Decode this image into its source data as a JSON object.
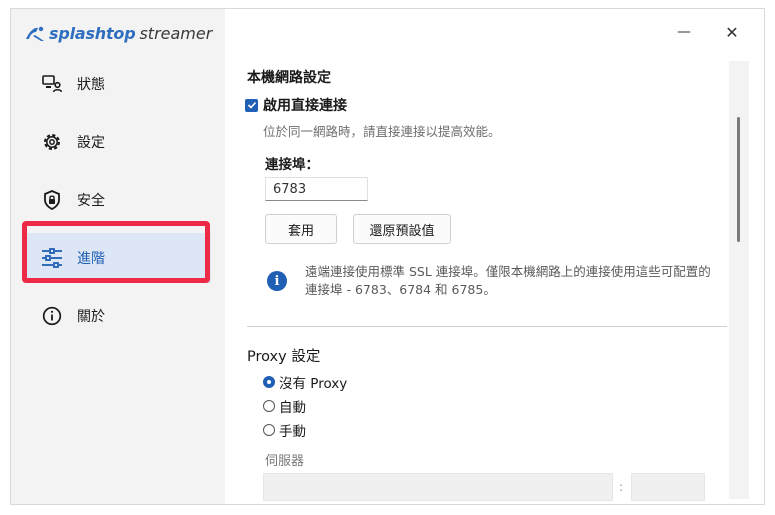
{
  "app": {
    "brand": "splashtop",
    "product": "streamer",
    "minimize_glyph": "—",
    "close_glyph": "✕"
  },
  "sidebar": {
    "items": [
      {
        "label": "狀態",
        "icon": "status-icon"
      },
      {
        "label": "設定",
        "icon": "gear-icon"
      },
      {
        "label": "安全",
        "icon": "shield-icon"
      },
      {
        "label": "進階",
        "icon": "sliders-icon",
        "active": true
      },
      {
        "label": "關於",
        "icon": "info-icon"
      }
    ]
  },
  "local_network": {
    "title": "本機網路設定",
    "enable_direct_label": "啟用直接連接",
    "enable_direct_checked": true,
    "enable_direct_desc": "位於同一網路時，請直接連接以提高效能。",
    "port_label": "連接埠：",
    "port_value": "6783",
    "apply_label": "套用",
    "restore_label": "還原預設值",
    "info_text": "遠端連接使用標準 SSL 連接埠。僅限本機網路上的連接使用這些可配置的連接埠 - 6783、6784 和 6785。"
  },
  "proxy": {
    "title": "Proxy 設定",
    "options": [
      {
        "label": "沒有 Proxy",
        "selected": true
      },
      {
        "label": "自動",
        "selected": false
      },
      {
        "label": "手動",
        "selected": false
      }
    ],
    "server_label": "伺服器",
    "separator": ":"
  },
  "colors": {
    "accent": "#1f5fb4",
    "active_bg": "#dde6f5",
    "highlight": "#ee2a47"
  }
}
